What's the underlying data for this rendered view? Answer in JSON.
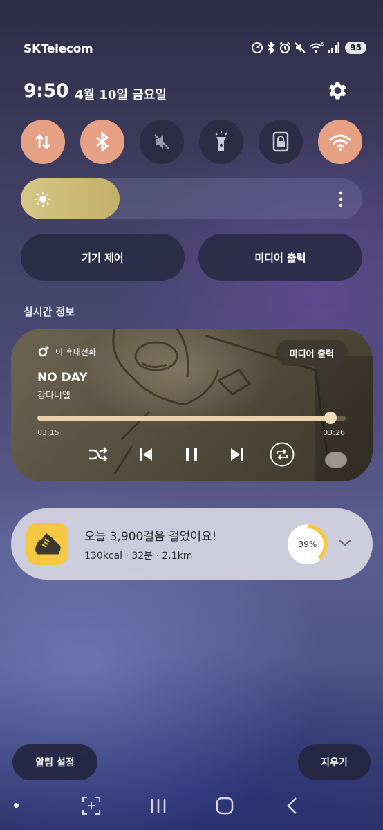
{
  "status_bar": {
    "carrier": "SKTelecom",
    "battery": "95",
    "icons": [
      "data-saver-icon",
      "bluetooth-icon",
      "alarm-icon",
      "mute-icon",
      "wifi-6-icon",
      "signal-icon",
      "battery-icon"
    ]
  },
  "header": {
    "time": "9:50",
    "date": "4월 10일 금요일"
  },
  "quick_toggles": [
    {
      "name": "mobile-data",
      "icon": "data-transfer-icon",
      "state": "on"
    },
    {
      "name": "bluetooth",
      "icon": "bluetooth-icon",
      "state": "on"
    },
    {
      "name": "sound",
      "icon": "mute-icon",
      "state": "off"
    },
    {
      "name": "flashlight",
      "icon": "flashlight-icon",
      "state": "off"
    },
    {
      "name": "rotation-lock",
      "icon": "lock-icon",
      "state": "off"
    },
    {
      "name": "wifi",
      "icon": "wifi-icon",
      "state": "on"
    }
  ],
  "brightness": {
    "level": 0.29
  },
  "controls": {
    "device_control": "기기 제어",
    "media_output": "미디어 출력"
  },
  "live_info_label": "실시간 정보",
  "media": {
    "source": "이 휴대전화",
    "output_button": "미디어 출력",
    "title": "NO DAY",
    "artist": "강다니엘",
    "current_time": "03:15",
    "total_time": "03:26",
    "progress": 0.95
  },
  "steps": {
    "title": "오늘 3,900걸음 걸었어요!",
    "stats": "130kcal · 32분 · 2.1km",
    "percent_label": "39%",
    "percent": 0.39
  },
  "bottom": {
    "notification_settings": "알림 설정",
    "clear": "지우기"
  },
  "colors": {
    "toggle_on": "#e6a184",
    "toggle_off": "#2c2d44",
    "brightness_fill": "#d6c787",
    "step_ring": "#f5c742"
  }
}
